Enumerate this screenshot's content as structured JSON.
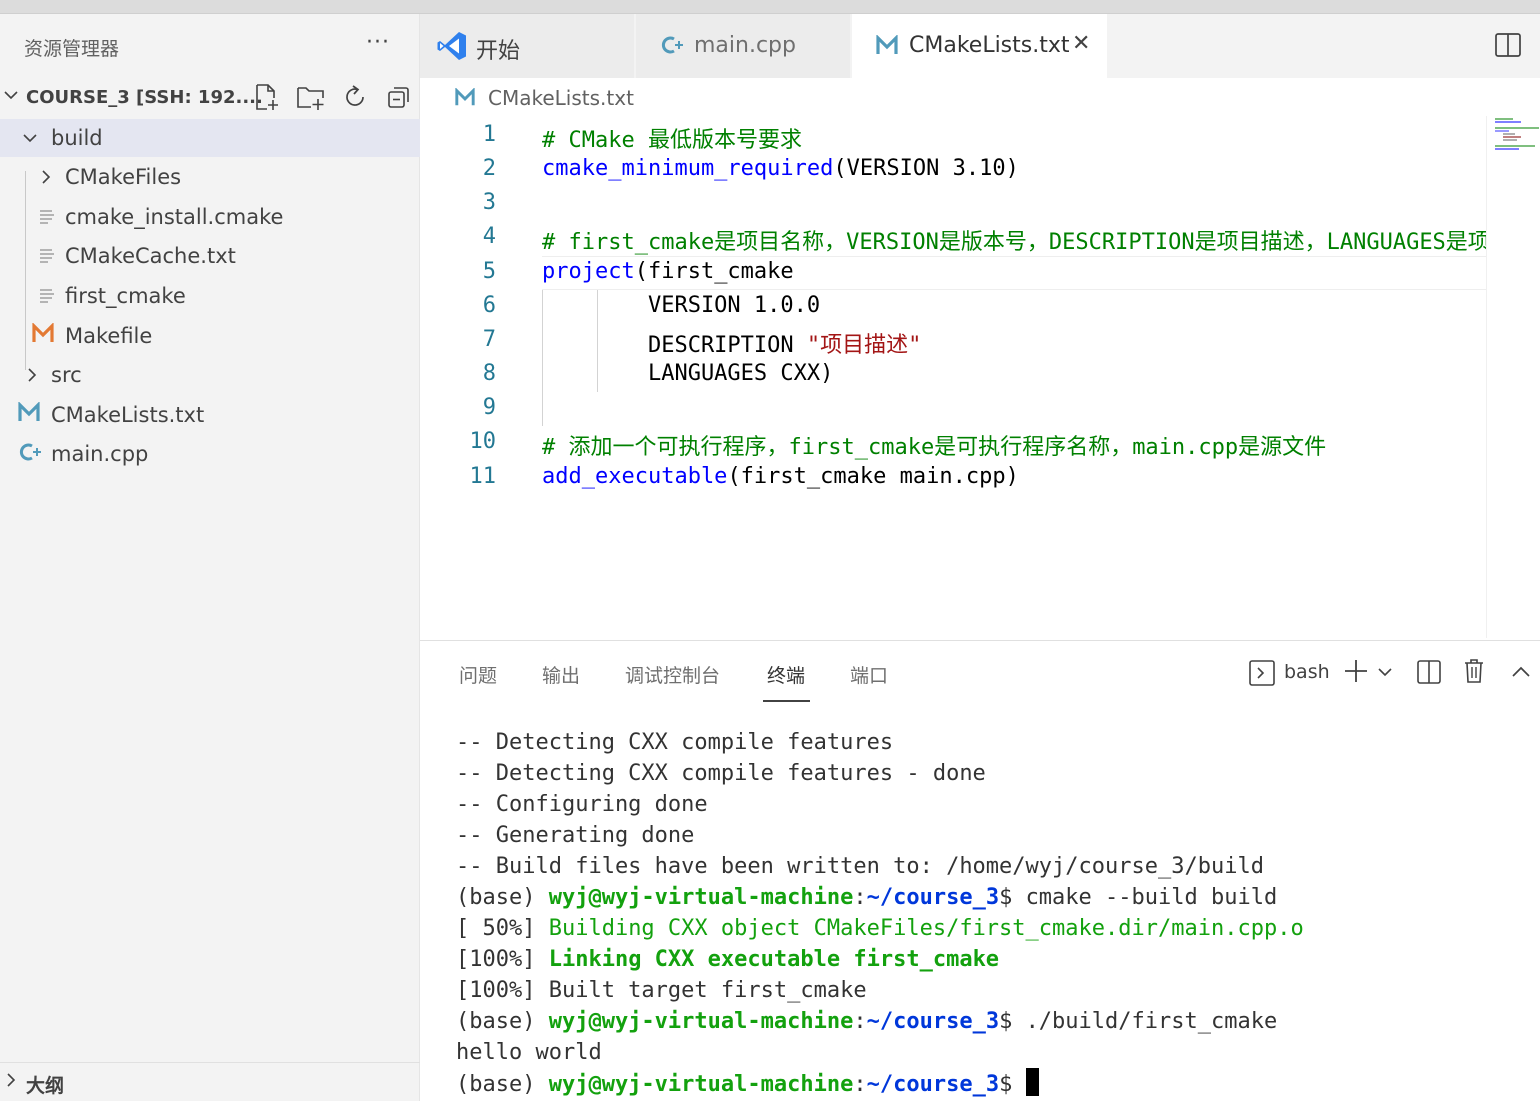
{
  "explorer": {
    "title": "资源管理器",
    "more": "···",
    "section_label": "COURSE_3 [SSH: 192....",
    "tree": [
      {
        "label": "build",
        "icon": "chevron-down-icon",
        "selected": true
      },
      {
        "label": "CMakeFiles",
        "icon": "chevron-right-icon"
      },
      {
        "label": "cmake_install.cmake",
        "icon": "file-lines-icon"
      },
      {
        "label": "CMakeCache.txt",
        "icon": "file-lines-icon"
      },
      {
        "label": "first_cmake",
        "icon": "file-lines-icon"
      },
      {
        "label": "Makefile",
        "icon": "makefile-m-icon"
      },
      {
        "label": "src",
        "icon": "chevron-right-icon"
      },
      {
        "label": "CMakeLists.txt",
        "icon": "cmake-m-icon"
      },
      {
        "label": "main.cpp",
        "icon": "cpp-icon"
      }
    ],
    "outline_label": "大纲"
  },
  "tabs": [
    {
      "label": "开始",
      "icon": "vscode-icon"
    },
    {
      "label": "main.cpp",
      "icon": "cpp-icon"
    },
    {
      "label": "CMakeLists.txt",
      "icon": "cmake-m-icon",
      "active": true,
      "close": "✕"
    }
  ],
  "breadcrumb": {
    "icon_letter": "M",
    "label": "CMakeLists.txt"
  },
  "editor": {
    "line_numbers": [
      "1",
      "2",
      "3",
      "4",
      "5",
      "6",
      "7",
      "8",
      "9",
      "10",
      "11"
    ],
    "line1": "# CMake 最低版本号要求",
    "line2_func": "cmake_minimum_required",
    "line2_rest": "(VERSION 3.10)",
    "line4": "# first_cmake是项目名称，VERSION是版本号，DESCRIPTION是项目描述，LANGUAGES是项目语言",
    "line5_func": "project",
    "line5_rest": "(first_cmake",
    "line6": "        VERSION 1.0.0",
    "line7_key": "        DESCRIPTION ",
    "line7_str": "\"项目描述\"",
    "line8": "        LANGUAGES CXX)",
    "line10": "# 添加一个可执行程序，first_cmake是可执行程序名称，main.cpp是源文件",
    "line11_func": "add_executable",
    "line11_rest": "(first_cmake main.cpp)"
  },
  "panel": {
    "tabs": [
      "问题",
      "输出",
      "调试控制台",
      "终端",
      "端口"
    ],
    "active_tab": "终端",
    "shell": "bash"
  },
  "terminal": {
    "lines_plain": [
      "-- Detecting CXX compile features",
      "-- Detecting CXX compile features - done",
      "-- Configuring done",
      "-- Generating done",
      "-- Build files have been written to: /home/wyj/course_3/build"
    ],
    "prompt_base": "(base) ",
    "prompt_user": "wyj@wyj-virtual-machine",
    "prompt_sep": ":",
    "prompt_path": "~/course_3",
    "prompt_end": "$ ",
    "cmd1": "cmake --build build",
    "build_prefix1": "[ 50%] ",
    "build_msg1": "Building CXX object CMakeFiles/first_cmake.dir/main.cpp.o",
    "build_prefix2": "[100%] ",
    "build_msg2": "Linking CXX executable first_cmake",
    "built": "[100%] Built target first_cmake",
    "cmd2": "./build/first_cmake",
    "output": "hello world"
  }
}
